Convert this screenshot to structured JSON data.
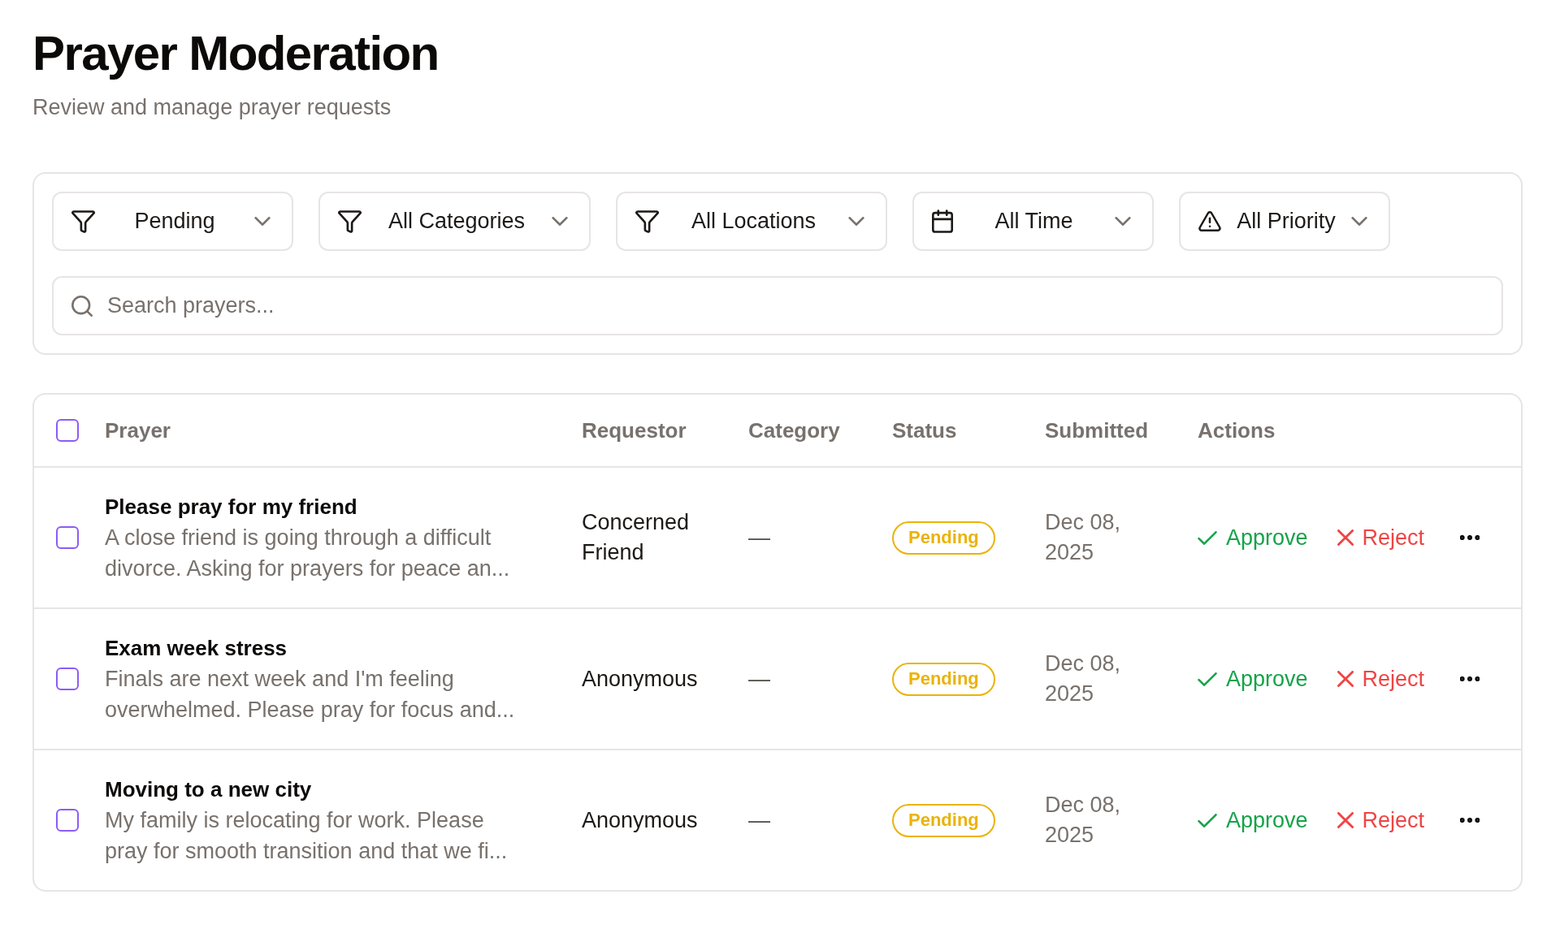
{
  "page": {
    "title": "Prayer Moderation",
    "subtitle": "Review and manage prayer requests"
  },
  "filters": [
    {
      "label": "Pending"
    },
    {
      "label": "All Categories"
    },
    {
      "label": "All Locations"
    },
    {
      "label": "All Time"
    },
    {
      "label": "All Priority"
    }
  ],
  "search": {
    "placeholder": "Search prayers..."
  },
  "table": {
    "select_all": {
      "checked": false
    },
    "columns": [
      "Prayer",
      "Requestor",
      "Category",
      "Status",
      "Submitted",
      "Actions"
    ],
    "rows": [
      {
        "checked": false,
        "title": "Please pray for my friend",
        "description": "A close friend is going through a difficult divorce. Asking for prayers for peace an...",
        "requestor": "Concerned Friend",
        "category": "—",
        "status": {
          "label": "Pending",
          "kind": "pending"
        },
        "submitted": "Dec 08, 2025",
        "actions": [
          {
            "label": "Approve",
            "kind": "approve"
          },
          {
            "label": "Reject",
            "kind": "reject"
          }
        ]
      },
      {
        "checked": false,
        "title": "Exam week stress",
        "description": "Finals are next week and I'm feeling overwhelmed. Please pray for focus and...",
        "requestor": "Anonymous",
        "category": "—",
        "status": {
          "label": "Pending",
          "kind": "pending"
        },
        "submitted": "Dec 08, 2025",
        "actions": [
          {
            "label": "Approve",
            "kind": "approve"
          },
          {
            "label": "Reject",
            "kind": "reject"
          }
        ]
      },
      {
        "checked": false,
        "title": "Moving to a new city",
        "description": "My family is relocating for work. Please pray for smooth transition and that we fi...",
        "requestor": "Anonymous",
        "category": "—",
        "status": {
          "label": "Pending",
          "kind": "pending"
        },
        "submitted": "Dec 08, 2025",
        "actions": [
          {
            "label": "Approve",
            "kind": "approve"
          },
          {
            "label": "Reject",
            "kind": "reject"
          }
        ]
      }
    ]
  }
}
